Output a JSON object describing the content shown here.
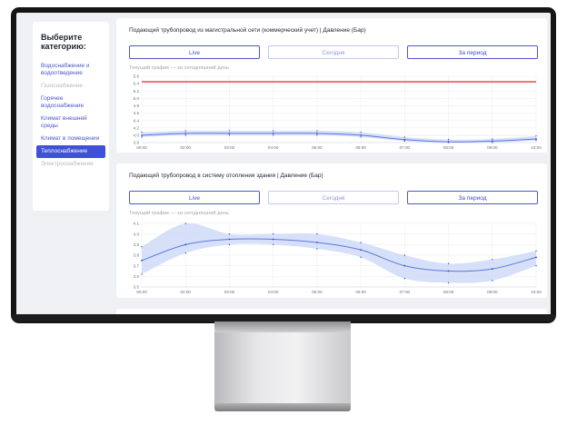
{
  "sidebar": {
    "title": "Выберите категорию:",
    "items": [
      {
        "label": "Водоснабжение и водоотведение",
        "state": "normal"
      },
      {
        "label": "Газоснабжение",
        "state": "disabled"
      },
      {
        "label": "Горячее водоснабжение",
        "state": "normal"
      },
      {
        "label": "Климат внешней среды",
        "state": "normal"
      },
      {
        "label": "Климат в помещении",
        "state": "normal"
      },
      {
        "label": "Теплоснабжение",
        "state": "active"
      },
      {
        "label": "Электроснабжение",
        "state": "disabled"
      }
    ]
  },
  "cards": [
    {
      "title": "Подающий трубопровод из магистральной сети (коммерческий учет) | Давление (Бар)",
      "buttons": [
        "Live",
        "Сегодня",
        "За период"
      ],
      "subtitle": "Текущий график — за сегодняшний день"
    },
    {
      "title": "Подающий трубопровод в систему отопления здания | Давление (Бар)",
      "buttons": [
        "Live",
        "Сегодня",
        "За период"
      ],
      "subtitle": "Текущий график — за сегодняшний день"
    }
  ],
  "colors": {
    "accent": "#3f51d6",
    "line": "#5b78e0",
    "band": "#c9d6f7",
    "limit": "#e23b3b"
  },
  "chart_data": [
    {
      "type": "line",
      "title": "Подающий трубопровод из магистральной сети (коммерческий учет) | Давление (Бар)",
      "x": [
        "00:00",
        "02:00",
        "03:00",
        "04:00",
        "05:00",
        "06:00",
        "07:00",
        "08:00",
        "09:00",
        "10:00"
      ],
      "ylim": [
        3.8,
        5.6
      ],
      "yticks": [
        "3.8",
        "4.0",
        "4.2",
        "4.4",
        "4.6",
        "4.8",
        "5.0",
        "5.2",
        "5.4",
        "5.6"
      ],
      "series": [
        {
          "values": [
            4.0,
            4.05,
            4.05,
            4.05,
            4.05,
            4.0,
            3.88,
            3.82,
            3.84,
            3.9
          ]
        }
      ],
      "band": {
        "low": [
          3.95,
          4.0,
          4.0,
          4.0,
          4.0,
          3.95,
          3.84,
          3.8,
          3.8,
          3.86
        ],
        "high": [
          4.08,
          4.12,
          4.12,
          4.12,
          4.12,
          4.08,
          3.95,
          3.88,
          3.9,
          3.98
        ]
      },
      "limit_line": 5.45,
      "grid": true
    },
    {
      "type": "line",
      "title": "Подающий трубопровод в систему отопления здания | Давление (Бар)",
      "x": [
        "00:00",
        "02:00",
        "03:00",
        "04:00",
        "05:00",
        "06:00",
        "07:00",
        "08:00",
        "09:00",
        "10:00"
      ],
      "ylim": [
        3.5,
        4.1
      ],
      "yticks": [
        "3.5",
        "3.6",
        "3.7",
        "3.8",
        "3.9",
        "4.0",
        "4.1"
      ],
      "series": [
        {
          "values": [
            3.75,
            3.9,
            3.95,
            3.95,
            3.92,
            3.85,
            3.7,
            3.65,
            3.67,
            3.78
          ]
        }
      ],
      "band": {
        "low": [
          3.62,
          3.82,
          3.9,
          3.9,
          3.86,
          3.78,
          3.58,
          3.54,
          3.56,
          3.7
        ],
        "high": [
          3.88,
          4.1,
          4.0,
          4.0,
          4.0,
          3.92,
          3.8,
          3.72,
          3.76,
          3.84
        ]
      },
      "grid": true
    }
  ]
}
